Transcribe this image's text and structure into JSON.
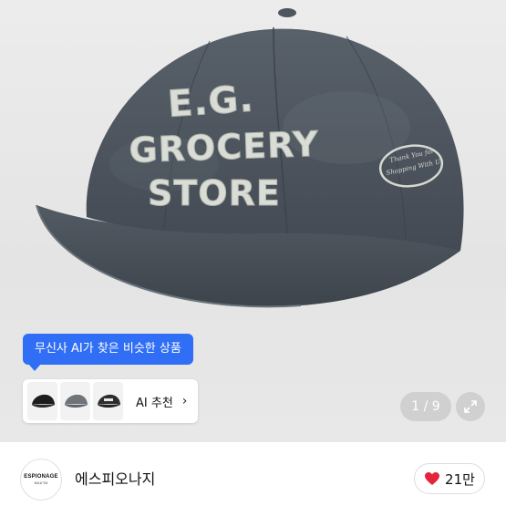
{
  "product": {
    "cap_front_text": [
      "E.G.",
      "GROCERY",
      "STORE"
    ],
    "cap_side_patch_text": [
      "Thank You for",
      "Shopping With Us"
    ]
  },
  "ai_recommend": {
    "tooltip": "무신사 AI가 찾은 비슷한 상품",
    "label": "AI 추천",
    "chevron": "›",
    "thumbnails": [
      "black-cap-thumb",
      "grey-cap-thumb",
      "charcoal-cap-thumb"
    ]
  },
  "gallery": {
    "counter": "1 / 9",
    "expand_icon": "expand-icon"
  },
  "brand": {
    "logo_main": "ESPIONAGE",
    "logo_sub": "KA1/°24",
    "name": "에스피오나지"
  },
  "like": {
    "count": "21만",
    "color": "#e5243b"
  },
  "colors": {
    "accent_blue": "#2f6ef5",
    "cap": "#4a525b"
  }
}
